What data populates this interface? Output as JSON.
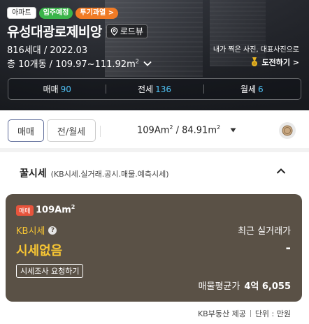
{
  "hero": {
    "type_badge": "아파트",
    "badge_move_in": "입주예정",
    "badge_overheat": "투기과열 >",
    "title": "유성대광로제비앙",
    "roadview_label": "로드뷰",
    "units_year": "816세대 / 2022.03",
    "buildings_area": "총 10개동 /  109.97~111.92m",
    "area_unit_sup": "2",
    "photo_note": "내가 찍은 사진, 대표사진으로",
    "challenge_label": "도전하기 >"
  },
  "deals": [
    {
      "label": "매매",
      "count": "90"
    },
    {
      "label": "전세",
      "count": "136"
    },
    {
      "label": "월세",
      "count": "6"
    }
  ],
  "filter": {
    "sale_tab": "매매",
    "rent_tab": "전/월세",
    "area_text_1": "109Am",
    "area_text_2": " / 84.91m",
    "sup": "2"
  },
  "section": {
    "title": "꿀시세",
    "subtitle": "(KB시세.실거래.공시.매물.예측시세)"
  },
  "card": {
    "badge": "매매",
    "area": "109Am",
    "area_sup": "2",
    "kb_label": "KB시세",
    "help": "?",
    "recent_label": "최근 실거래가",
    "no_price": "시세없음",
    "recent_value": "-",
    "request_button": "시세조사 요청하기",
    "avg_label": "매물평균가",
    "avg_value": "4억 6,055"
  },
  "footer": {
    "source": "KB부동산 제공",
    "unit": "단위 : 만원"
  },
  "colors": {
    "accent_blue": "#4fc3f7",
    "kb_yellow": "#f7c533",
    "card_bg": "#5a5146",
    "badge_green": "#3ab54a",
    "badge_orange": "#f07b25",
    "sale_badge_red": "#e8543c"
  },
  "icons": [
    "location-pin-icon",
    "chevron-down-icon",
    "medal-icon",
    "dropdown-triangle-icon",
    "coin-icon",
    "chevron-up-icon",
    "help-icon"
  ]
}
